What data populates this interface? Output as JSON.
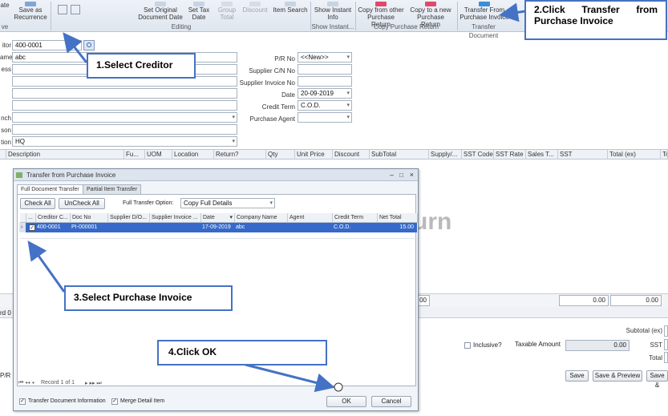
{
  "ribbon": {
    "buttons": [
      {
        "label": "ate",
        "disabled": false
      },
      {
        "label": "Save as Recurrence",
        "disabled": false
      },
      {
        "label": "Set Original Document Date",
        "disabled": false
      },
      {
        "label": "Set Tax Date",
        "disabled": false
      },
      {
        "label": "Group Total",
        "disabled": true
      },
      {
        "label": "Discount",
        "disabled": true
      },
      {
        "label": "Item Search",
        "disabled": false
      },
      {
        "label": "Show Instant Info",
        "disabled": false
      },
      {
        "label": "Copy from other Purchase Return",
        "disabled": false
      },
      {
        "label": "Copy to a new Purchase Return",
        "disabled": false
      },
      {
        "label": "Transfer From Purchase Invoice",
        "disabled": false
      }
    ],
    "groups": [
      "ve",
      "Editing",
      "Show Instant...",
      "Copy Purchase Return",
      "Transfer Document"
    ]
  },
  "form": {
    "creditor_label": "itor",
    "creditor_value": "400-0001",
    "name_label": "ame",
    "name_value": "abc",
    "address_label": "ess",
    "branch_label": "nch",
    "person_label": "son",
    "location_label": "tion",
    "location_value": "HQ",
    "pr_no_label": "P/R No",
    "pr_no_value": "<<New>>",
    "supplier_cn_label": "Supplier C/N No",
    "supplier_invoice_label": "Supplier Invoice No",
    "date_label": "Date",
    "date_value": "20-09-2019",
    "credit_term_label": "Credit Term",
    "credit_term_value": "C.O.D.",
    "purchase_agent_label": "Purchase Agent"
  },
  "detail_columns": [
    "Description",
    "Fu...",
    "UOM",
    "Location",
    "Return?",
    "Qty",
    "Unit Price",
    "Discount",
    "SubTotal",
    "Supply/...",
    "SST Code",
    "SST Rate",
    "Sales T...",
    "SST",
    "Total (ex)",
    "To"
  ],
  "watermark": "urn",
  "bottom": {
    "record_left": "rd 0",
    "pr_label": "P/R",
    "grid_total_1": "00",
    "grid_total_2": "0.00",
    "grid_total_3": "0.00",
    "subtotal_label": "Subtotal (ex)",
    "inclusive_label": "Inclusive?",
    "taxable_label": "Taxable Amount",
    "taxable_value": "0.00",
    "sst_label": "SST",
    "total_label": "Total",
    "save": "Save",
    "save_preview": "Save & Preview",
    "save_cut": "Save &"
  },
  "dialog": {
    "title": "Transfer from Purchase Invoice",
    "tabs": [
      "Full Document Transfer",
      "Partial Item Transfer"
    ],
    "check_all": "Check All",
    "uncheck_all": "UnCheck All",
    "option_label": "Full Transfer Option:",
    "option_value": "Copy Full Details",
    "columns": [
      "...",
      "Creditor C...",
      "Doc No",
      "Supplier D/O...",
      "Supplier Invoice ...",
      "Date",
      "Company Name",
      "Agent",
      "Credit Term",
      "Net Total"
    ],
    "row": {
      "creditor": "400-0001",
      "doc_no": "PI-000001",
      "date": "17-09-2019",
      "company": "abc",
      "credit_term": "C.O.D.",
      "net_total": "15.00"
    },
    "record_text": "Record 1 of 1",
    "transfer_info": "Transfer Document Information",
    "merge_detail": "Merge Detail Item",
    "ok": "OK",
    "cancel": "Cancel"
  },
  "callouts": {
    "c1": "1.Select Creditor",
    "c2": "2.Click  Transfer  from Purchase Invoice",
    "c3": "3.Select  Purchase Invoice",
    "c4": "4.Click OK"
  },
  "colors": {
    "callout_border": "#4472c4",
    "selected_row": "#3669c9"
  }
}
